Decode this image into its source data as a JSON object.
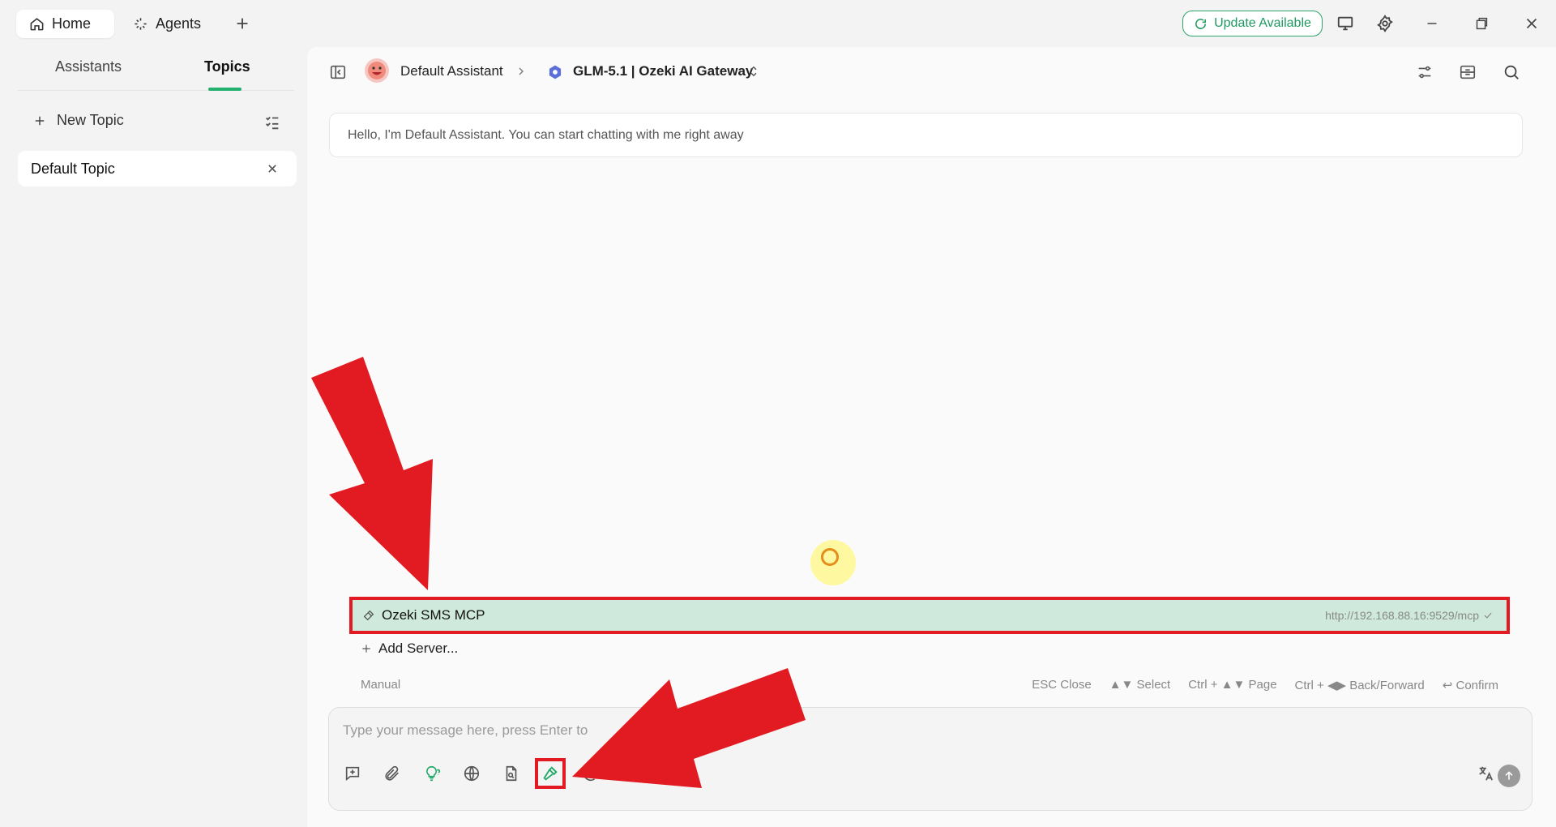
{
  "tabs": {
    "home": "Home",
    "agents": "Agents"
  },
  "topbar": {
    "update_label": "Update Available"
  },
  "sidebar": {
    "tab_assistants": "Assistants",
    "tab_topics": "Topics",
    "new_topic": "New Topic",
    "topics": [
      "Default Topic"
    ]
  },
  "header": {
    "assistant_name": "Default Assistant",
    "model_name": "GLM-5.1 | Ozeki AI Gateway"
  },
  "chat": {
    "greeting": "Hello, I'm Default Assistant. You can start chatting with me right away"
  },
  "mcp_popup": {
    "server_name": "Ozeki SMS MCP",
    "server_url": "http://192.168.88.16:9529/mcp",
    "add_server": "Add Server...",
    "mode": "Manual",
    "hints": [
      "ESC Close",
      "▲▼ Select",
      "Ctrl + ▲▼ Page",
      "Ctrl + ◀▶ Back/Forward",
      "↩ Confirm"
    ]
  },
  "input": {
    "placeholder": "Type your message here, press Enter to"
  },
  "colors": {
    "accent_green": "#22b06f",
    "annotation_red": "#e21a22",
    "selected_row": "#cfeadc"
  }
}
